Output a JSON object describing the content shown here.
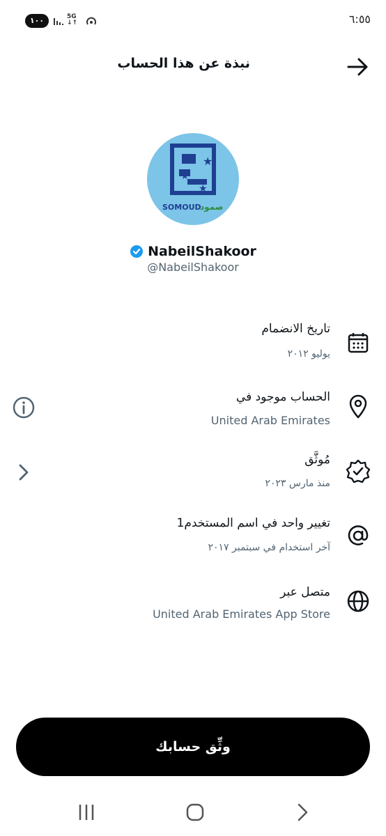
{
  "status_bar": {
    "time": "٦:٥٥",
    "battery": "١٠٠",
    "network": "5G"
  },
  "header": {
    "title": "نبذة عن هذا الحساب",
    "back_icon": "arrow-right-icon"
  },
  "profile": {
    "display_name": "NabeilShakoor",
    "handle": "@NabeilShakoor",
    "verified": true,
    "verified_color": "#1d9bf0",
    "avatar_bg": "#7cc4e8",
    "avatar_logo_text_en": "SOMOUD",
    "avatar_logo_text_ar": "صمود"
  },
  "rows": [
    {
      "title": "تاريخ الانضمام",
      "subtitle": "يوليو ٢٠١٢",
      "icon": "calendar-icon"
    },
    {
      "title": "الحساب موجود في",
      "subtitle": "United Arab Emirates",
      "icon": "location-pin-icon",
      "side_icon": "info-icon"
    },
    {
      "title": "مُوثَّق",
      "subtitle": "منذ مارس ٢٠٢٣",
      "icon": "verified-badge-icon",
      "side_icon": "chevron-left-icon"
    },
    {
      "title": "تغيير واحد في اسم المستخدم1",
      "subtitle": "آخر استخدام في سبتمبر ٢٠١٧",
      "icon": "at-sign-icon"
    },
    {
      "title": "متصل عبر",
      "subtitle": "United Arab Emirates App Store",
      "icon": "globe-icon"
    }
  ],
  "verify_button": {
    "label": "وثِّق حسابك"
  },
  "nav_bar": {
    "recents_icon": "recents-icon",
    "home_icon": "home-icon",
    "back_icon": "back-chevron-icon"
  }
}
